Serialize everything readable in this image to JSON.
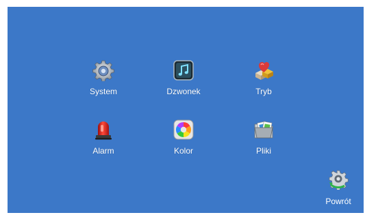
{
  "menu": {
    "items": [
      {
        "label": "System",
        "icon": "gear-icon"
      },
      {
        "label": "Dzwonek",
        "icon": "music-note-icon"
      },
      {
        "label": "Tryb",
        "icon": "mode-cubes-icon"
      },
      {
        "label": "Alarm",
        "icon": "siren-icon"
      },
      {
        "label": "Kolor",
        "icon": "color-palette-icon"
      },
      {
        "label": "Pliki",
        "icon": "folder-files-icon"
      }
    ]
  },
  "back": {
    "label": "Powrót",
    "icon": "back-gear-icon"
  },
  "colors": {
    "background": "#3c78c8",
    "text": "#ffffff"
  }
}
